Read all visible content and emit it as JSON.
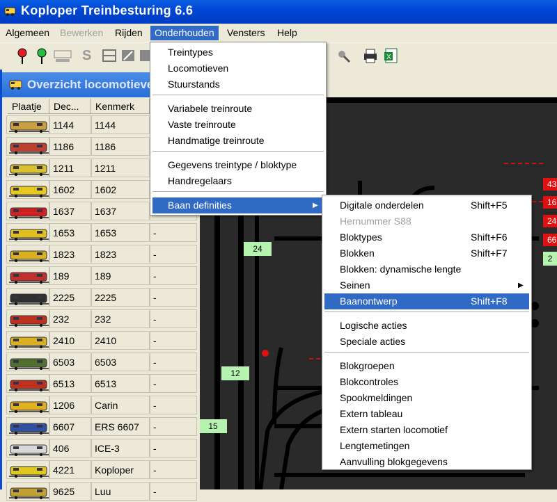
{
  "app": {
    "title": "Koploper Treinbesturing 6.6"
  },
  "menubar": [
    {
      "label": "Algemeen",
      "state": "normal"
    },
    {
      "label": "Bewerken",
      "state": "disabled"
    },
    {
      "label": "Rijden",
      "state": "normal"
    },
    {
      "label": "Onderhouden",
      "state": "active"
    },
    {
      "label": "Vensters",
      "state": "normal"
    },
    {
      "label": "Help",
      "state": "normal"
    }
  ],
  "toolbar": {
    "icons": [
      "signal-red-icon",
      "signal-green-icon",
      "decoder-icon",
      "s-icon",
      "block-icon",
      "edit-icon",
      "close-icon",
      "tool-icon",
      "tool2-icon",
      "printer-icon",
      "excel-icon"
    ]
  },
  "loco_window": {
    "title": "Overzicht locomotieven",
    "columns": [
      "Plaatje",
      "Dec...",
      "Kenmerk"
    ],
    "rows": [
      {
        "dec": "1144",
        "kenmerk": "1144",
        "extra": "",
        "color": "#c8a040"
      },
      {
        "dec": "1186",
        "kenmerk": "1186",
        "extra": "",
        "color": "#c04030"
      },
      {
        "dec": "1211",
        "kenmerk": "1211",
        "extra": "",
        "color": "#d8c030"
      },
      {
        "dec": "1602",
        "kenmerk": "1602",
        "extra": "",
        "color": "#e8c820"
      },
      {
        "dec": "1637",
        "kenmerk": "1637",
        "extra": "",
        "color": "#d02020"
      },
      {
        "dec": "1653",
        "kenmerk": "1653",
        "extra": "-",
        "color": "#e0c020"
      },
      {
        "dec": "1823",
        "kenmerk": "1823",
        "extra": "-",
        "color": "#d8b020"
      },
      {
        "dec": "189",
        "kenmerk": "189",
        "extra": "-",
        "color": "#c03030"
      },
      {
        "dec": "2225",
        "kenmerk": "2225",
        "extra": "-",
        "color": "#303030"
      },
      {
        "dec": "232",
        "kenmerk": "232",
        "extra": "-",
        "color": "#c03020"
      },
      {
        "dec": "2410",
        "kenmerk": "2410",
        "extra": "-",
        "color": "#d8b020"
      },
      {
        "dec": "6503",
        "kenmerk": "6503",
        "extra": "-",
        "color": "#507030"
      },
      {
        "dec": "6513",
        "kenmerk": "6513",
        "extra": "-",
        "color": "#c03020"
      },
      {
        "dec": "1206",
        "kenmerk": "Carin",
        "extra": "-",
        "color": "#e0b020"
      },
      {
        "dec": "6607",
        "kenmerk": "ERS 6607",
        "extra": "-",
        "color": "#3050a0"
      },
      {
        "dec": "406",
        "kenmerk": "ICE-3",
        "extra": "-",
        "color": "#d8d8d8"
      },
      {
        "dec": "4221",
        "kenmerk": "Koploper",
        "extra": "-",
        "color": "#e0c820"
      },
      {
        "dec": "9625",
        "kenmerk": "Luu",
        "extra": "-",
        "color": "#c0a030"
      }
    ]
  },
  "track": {
    "blocks": [
      "24",
      "12",
      "15"
    ],
    "red_blocks": [
      "43",
      "16",
      "24",
      "66"
    ],
    "side_block": "2"
  },
  "onderhouden_menu": {
    "items": [
      {
        "label": "Treintypes"
      },
      {
        "label": "Locomotieven"
      },
      {
        "label": "Stuurstands"
      },
      {
        "sep": true
      },
      {
        "label": "Variabele treinroute"
      },
      {
        "label": "Vaste treinroute"
      },
      {
        "label": "Handmatige treinroute"
      },
      {
        "sep": true
      },
      {
        "label": "Gegevens treintype / bloktype"
      },
      {
        "label": "Handregelaars"
      },
      {
        "sep": true
      },
      {
        "label": "Baan definities",
        "submenu": true,
        "selected": true
      }
    ]
  },
  "baan_submenu": {
    "items": [
      {
        "label": "Digitale onderdelen",
        "shortcut": "Shift+F5"
      },
      {
        "label": "Hernummer S88",
        "disabled": true
      },
      {
        "label": "Bloktypes",
        "shortcut": "Shift+F6"
      },
      {
        "label": "Blokken",
        "shortcut": "Shift+F7"
      },
      {
        "label": "Blokken: dynamische lengte"
      },
      {
        "label": "Seinen",
        "submenu": true
      },
      {
        "label": "Baanontwerp",
        "shortcut": "Shift+F8",
        "selected": true
      },
      {
        "sep": true
      },
      {
        "label": "Logische acties"
      },
      {
        "label": "Speciale acties"
      },
      {
        "sep": true
      },
      {
        "label": "Blokgroepen"
      },
      {
        "label": "Blokcontroles"
      },
      {
        "label": "Spookmeldingen"
      },
      {
        "label": "Extern tableau"
      },
      {
        "label": "Extern starten locomotief"
      },
      {
        "label": "Lengtemetingen"
      },
      {
        "label": "Aanvulling blokgegevens"
      }
    ]
  }
}
